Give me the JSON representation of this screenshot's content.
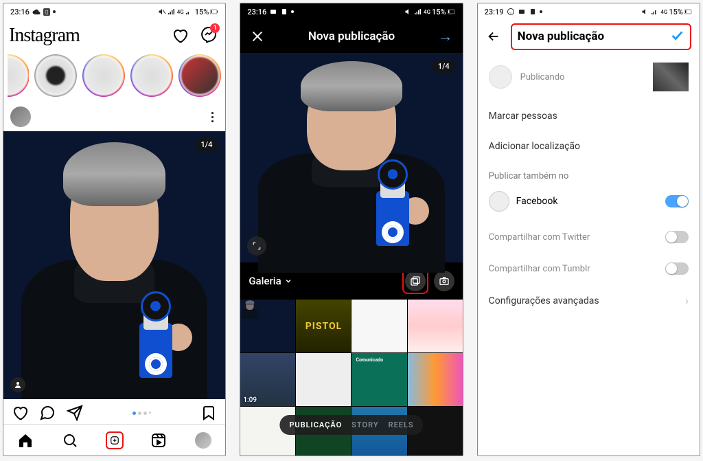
{
  "status": {
    "time1": "23:16",
    "time2": "23:16",
    "time3": "23:19",
    "batt": "15%",
    "net": "4G"
  },
  "screen1": {
    "logo": "Instagram",
    "notif_count": "1",
    "post_badge": "1/4",
    "nav": {
      "home": "home-icon",
      "search": "search-icon",
      "add": "add-icon",
      "reels": "reels-icon",
      "profile": "profile"
    }
  },
  "screen2": {
    "title": "Nova publicação",
    "badge": "1/4",
    "gallery_label": "Galeria",
    "video_dur": "1:09",
    "modes": {
      "pub": "PUBLICAÇÃO",
      "story": "STORY",
      "reels": "REELS"
    },
    "thumb_text": {
      "comunicado": "Comunicado"
    }
  },
  "screen3": {
    "title": "Nova publicação",
    "caption": "Publicando",
    "tag_people": "Marcar pessoas",
    "add_location": "Adicionar localização",
    "also_publish": "Publicar também no",
    "facebook": "Facebook",
    "twitter": "Compartilhar com Twitter",
    "tumblr": "Compartilhar com Tumblr",
    "advanced": "Configurações avançadas"
  }
}
